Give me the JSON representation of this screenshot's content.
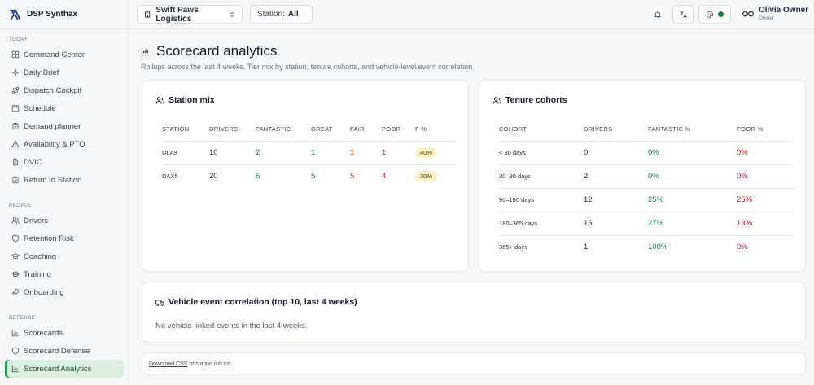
{
  "app": {
    "name": "DSP Synthax"
  },
  "sidebar": {
    "sections": [
      {
        "label": "TODAY",
        "items": [
          {
            "label": "Command Center",
            "icon": "grid-icon"
          },
          {
            "label": "Daily Brief",
            "icon": "sparkle-icon"
          },
          {
            "label": "Dispatch Cockpit",
            "icon": "route-icon"
          },
          {
            "label": "Schedule",
            "icon": "calendar-icon"
          },
          {
            "label": "Demand planner",
            "icon": "clipboard-icon"
          },
          {
            "label": "Availability & PTO",
            "icon": "warning-icon"
          },
          {
            "label": "DVIC",
            "icon": "document-icon"
          },
          {
            "label": "Return to Station",
            "icon": "clipboard-check-icon"
          }
        ]
      },
      {
        "label": "PEOPLE",
        "items": [
          {
            "label": "Drivers",
            "icon": "users-icon"
          },
          {
            "label": "Retention Risk",
            "icon": "shield-icon"
          },
          {
            "label": "Coaching",
            "icon": "graduation-icon"
          },
          {
            "label": "Training",
            "icon": "hat-icon"
          },
          {
            "label": "Onboarding",
            "icon": "rocket-icon"
          }
        ]
      },
      {
        "label": "DEFENSE",
        "items": [
          {
            "label": "Scorecards",
            "icon": "bar-chart-icon"
          },
          {
            "label": "Scorecard Defense",
            "icon": "shield-icon"
          },
          {
            "label": "Scorecard Analytics",
            "icon": "bar-chart-icon",
            "active": true
          }
        ]
      }
    ]
  },
  "topbar": {
    "org": "Swift Paws Logistics",
    "station_label": "Station:",
    "station_value": "All",
    "user_name": "Olivia Owner",
    "user_role": "Owner"
  },
  "page": {
    "title": "Scorecard analytics",
    "subtitle": "Rollups across the last 4 weeks. Tier mix by station, tenure cohorts, and vehicle-level event correlation."
  },
  "station_mix": {
    "title": "Station mix",
    "headers": [
      "STATION",
      "DRIVERS",
      "FANTASTIC",
      "GREAT",
      "FAIR",
      "POOR",
      "F %"
    ],
    "rows": [
      {
        "station": "DLA9",
        "drivers": "10",
        "fantastic": "2",
        "great": "1",
        "fair": "1",
        "poor": "1",
        "fpct": "40%"
      },
      {
        "station": "DAX5",
        "drivers": "20",
        "fantastic": "6",
        "great": "5",
        "fair": "5",
        "poor": "4",
        "fpct": "30%"
      }
    ]
  },
  "tenure": {
    "title": "Tenure cohorts",
    "headers": [
      "COHORT",
      "DRIVERS",
      "FANTASTIC %",
      "POOR %"
    ],
    "rows": [
      {
        "cohort": "< 30 days",
        "drivers": "0",
        "fantastic": "0%",
        "poor": "0%"
      },
      {
        "cohort": "30–90 days",
        "drivers": "2",
        "fantastic": "0%",
        "poor": "0%"
      },
      {
        "cohort": "90–180 days",
        "drivers": "12",
        "fantastic": "25%",
        "poor": "25%"
      },
      {
        "cohort": "180–365 days",
        "drivers": "15",
        "fantastic": "27%",
        "poor": "13%"
      },
      {
        "cohort": "365+ days",
        "drivers": "1",
        "fantastic": "100%",
        "poor": "0%"
      }
    ]
  },
  "vehicle": {
    "title": "Vehicle event correlation (top 10, last 4 weeks)",
    "empty": "No vehicle-linked events in the last 4 weeks."
  },
  "footer": {
    "link": "Download CSV",
    "text": " of station rollups."
  },
  "colors": {
    "accent": "#16a34a",
    "good": "#15803d",
    "fair": "#c2410c",
    "poor": "#b91c1c",
    "badge": "#fdf0c4"
  }
}
